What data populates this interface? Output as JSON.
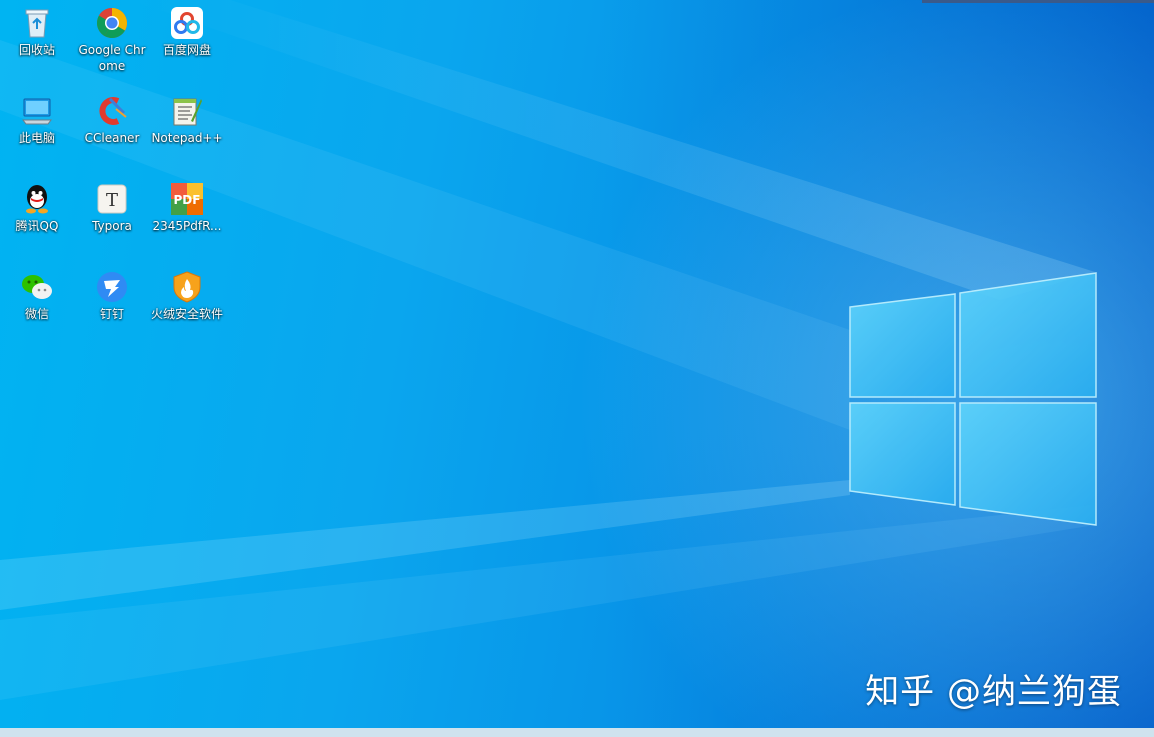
{
  "desktop": {
    "icons": [
      {
        "label": "回收站",
        "icon": "recycle-bin-icon"
      },
      {
        "label": "Google Chrome",
        "icon": "chrome-icon"
      },
      {
        "label": "百度网盘",
        "icon": "baidu-netdisk-icon"
      },
      {
        "label": "此电脑",
        "icon": "this-pc-icon"
      },
      {
        "label": "CCleaner",
        "icon": "ccleaner-icon"
      },
      {
        "label": "Notepad++",
        "icon": "notepadpp-icon"
      },
      {
        "label": "腾讯QQ",
        "icon": "qq-icon"
      },
      {
        "label": "Typora",
        "icon": "typora-icon"
      },
      {
        "label": "2345PdfR...",
        "icon": "pdf-reader-icon"
      },
      {
        "label": "微信",
        "icon": "wechat-icon"
      },
      {
        "label": "钉钉",
        "icon": "dingtalk-icon"
      },
      {
        "label": "火绒安全软件",
        "icon": "huorong-icon"
      }
    ]
  },
  "watermark": {
    "text": "知乎 @纳兰狗蛋"
  },
  "colors": {
    "wallpaper_light": "#00b4f2",
    "wallpaper_dark": "#0570d8",
    "logo_pane": "#3cc0f5"
  }
}
